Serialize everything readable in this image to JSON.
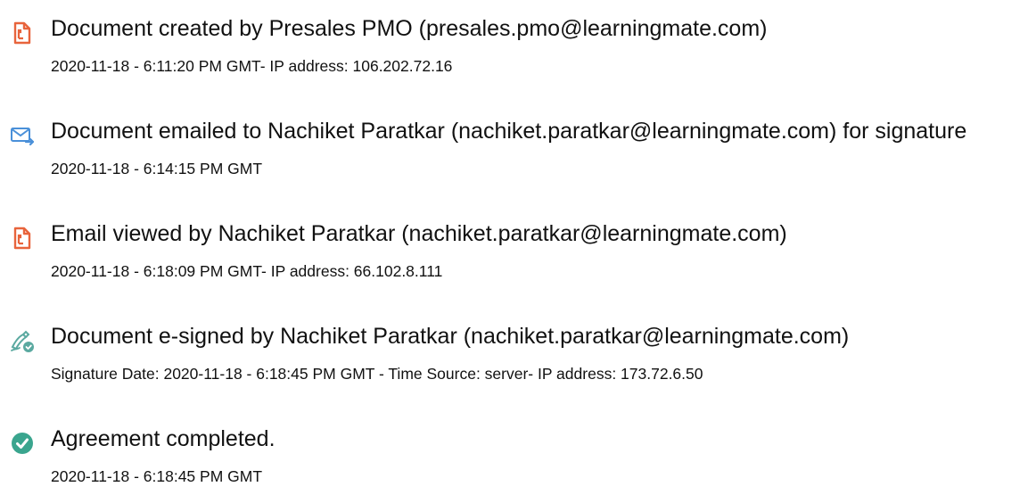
{
  "events": [
    {
      "icon": "document-created-icon",
      "title": "Document created by Presales PMO (presales.pmo@learningmate.com)",
      "detail": "2020-11-18 - 6:11:20 PM GMT- IP address: 106.202.72.16"
    },
    {
      "icon": "email-sent-icon",
      "title": "Document emailed to Nachiket Paratkar (nachiket.paratkar@learningmate.com) for signature",
      "detail": "2020-11-18 - 6:14:15 PM GMT"
    },
    {
      "icon": "document-viewed-icon",
      "title": "Email viewed by Nachiket Paratkar (nachiket.paratkar@learningmate.com)",
      "detail": "2020-11-18 - 6:18:09 PM GMT- IP address: 66.102.8.111"
    },
    {
      "icon": "e-sign-icon",
      "title": "Document e-signed by Nachiket Paratkar (nachiket.paratkar@learningmate.com)",
      "detail": "Signature Date: 2020-11-18 - 6:18:45 PM GMT - Time Source: server- IP address: 173.72.6.50"
    },
    {
      "icon": "check-circle-icon",
      "title": "Agreement completed.",
      "detail": "2020-11-18 - 6:18:45 PM GMT"
    }
  ],
  "colors": {
    "document_icon": "#e8643c",
    "email_icon": "#4a90d9",
    "sign_icon": "#5aa9a0",
    "complete_icon": "#3aa58e",
    "text": "#111111"
  }
}
